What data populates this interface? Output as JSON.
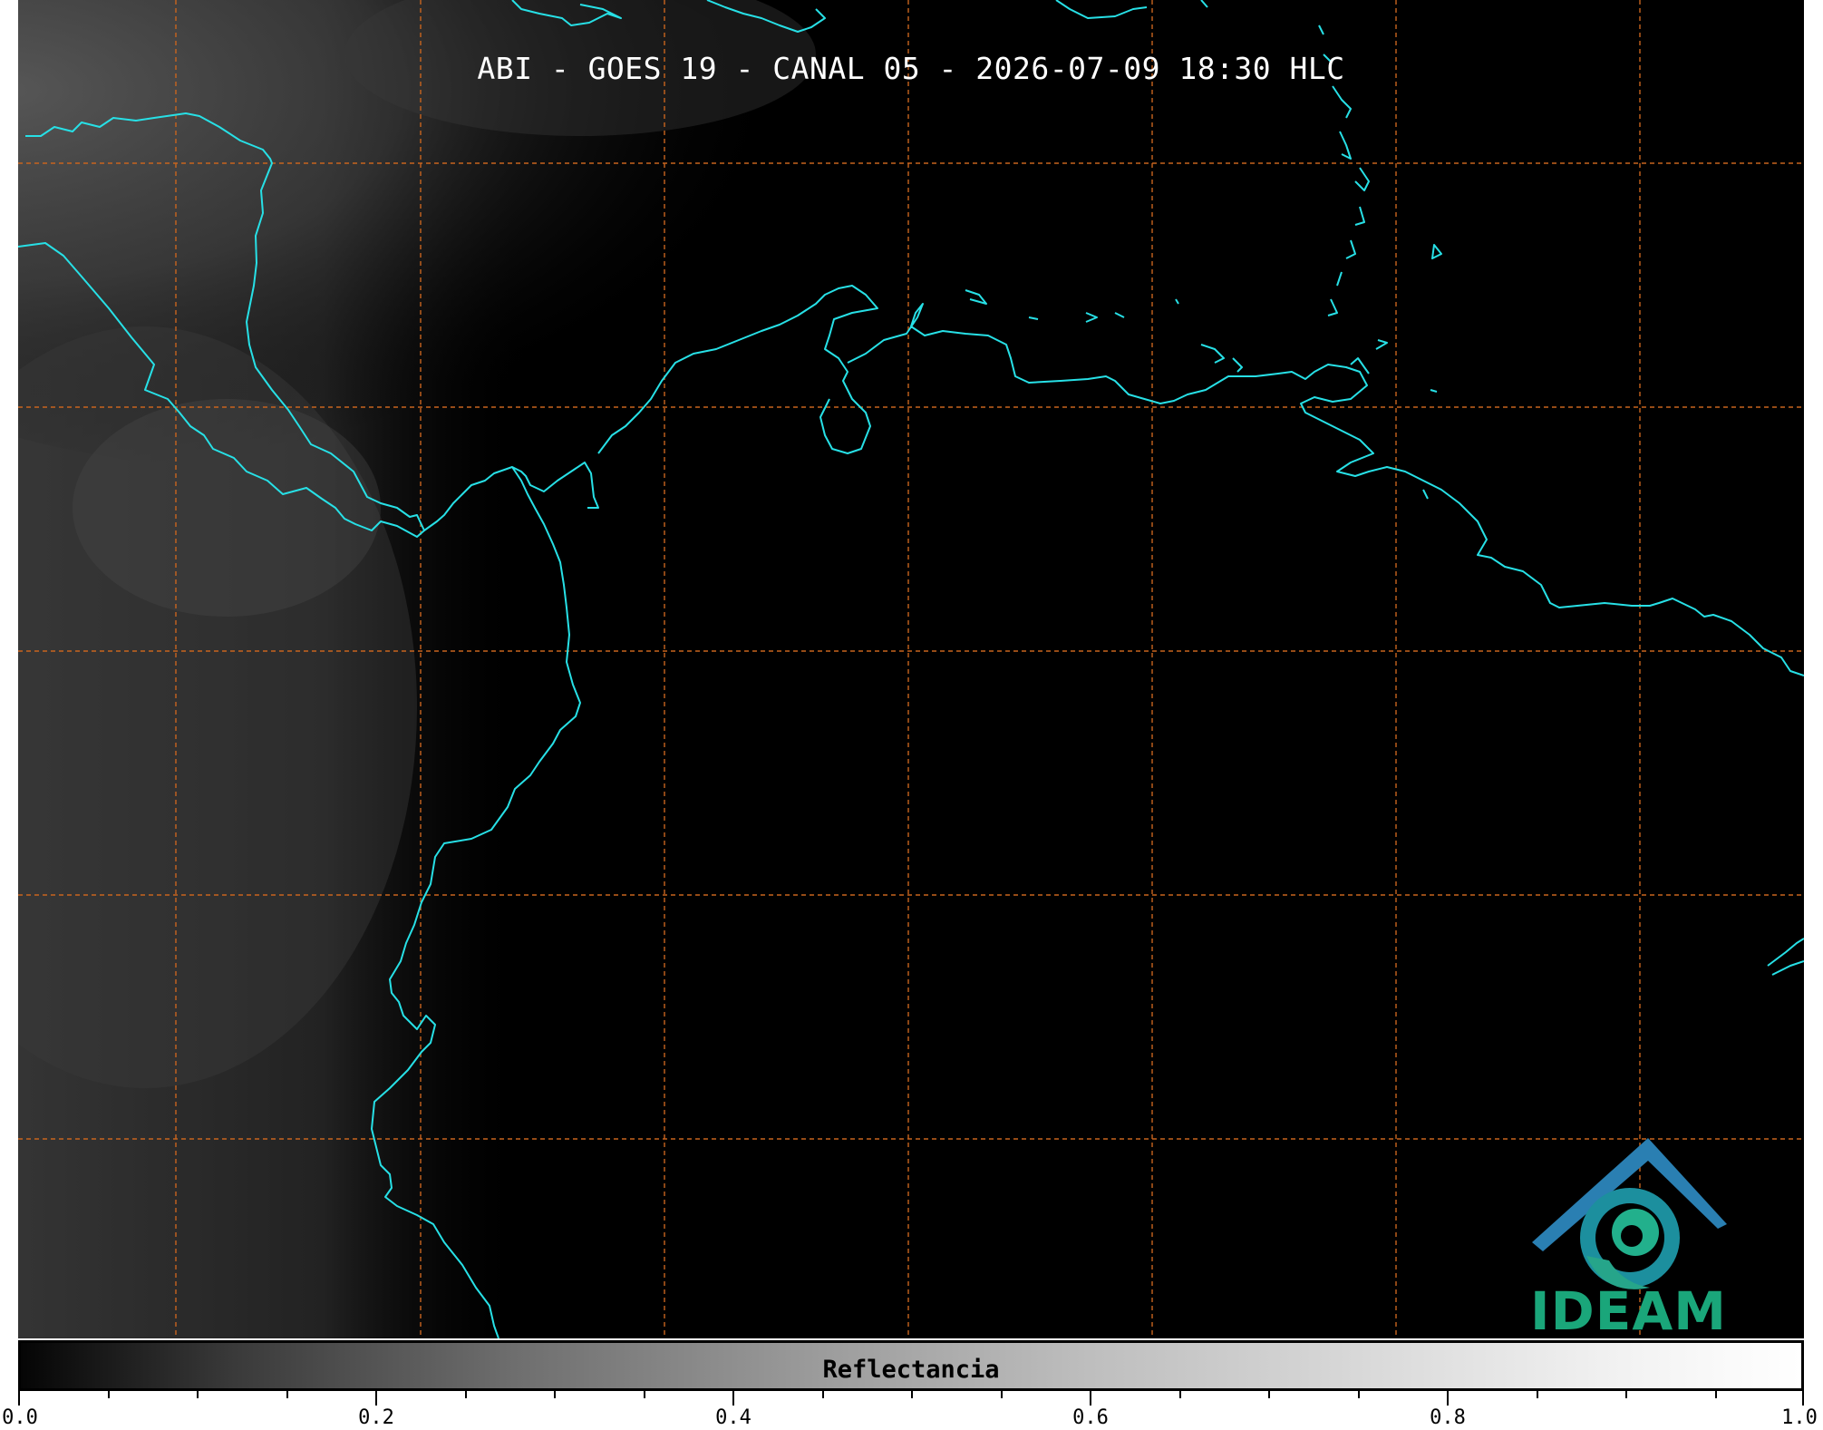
{
  "map": {
    "title": "ABI - GOES 19 - CANAL 05 - 2026-07-09 18:30 HLC",
    "channel": "CANAL 05",
    "satellite": "GOES 19",
    "instrument": "ABI",
    "coastline_color": "#27e0e6",
    "gridline_color": "#c8641e",
    "background_color": "#000000"
  },
  "colorbar": {
    "label": "Reflectancia",
    "ticks": [
      "0.0",
      "0.2",
      "0.4",
      "0.6",
      "0.8",
      "1.0"
    ],
    "range": [
      0.0,
      1.0
    ]
  },
  "logo": {
    "text": "IDEAM",
    "color": "#1aa67a"
  }
}
